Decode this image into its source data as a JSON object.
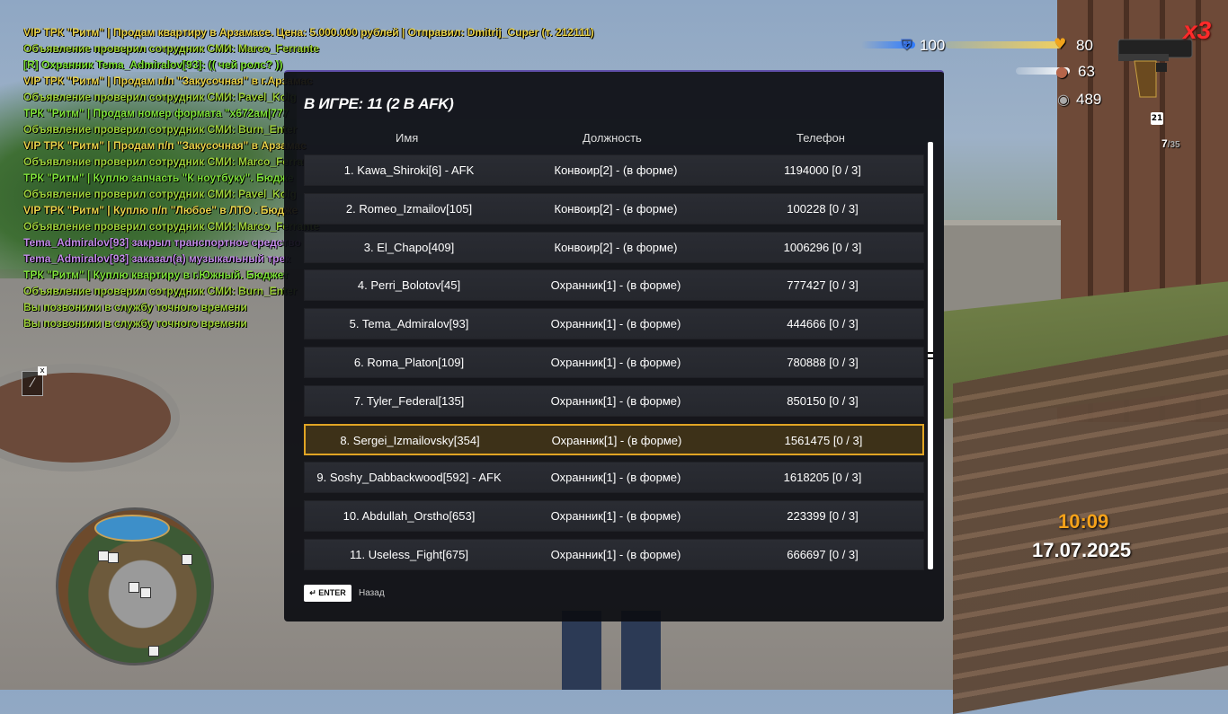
{
  "chat": [
    {
      "text": "VIP ТРК \"Ритм\" | Продам квартиру в Арзамасе. Цена: 5.000.000 рублей | Отправил: Dmitrij_Cuper (т. 212111)",
      "color": "yellow"
    },
    {
      "text": " Объявление проверил сотрудник СМИ: Marco_Ferrante",
      "color": "green"
    },
    {
      "text": "[R] Охранник Tema_Admiralov[93]: (( чей ролс? ))",
      "color": "lime"
    },
    {
      "text": "VIP ТРК \"Ритм\" | Продам п/п \"Закусочная\" в г.Арзамас",
      "color": "yellow"
    },
    {
      "text": " Объявление проверил сотрудник СМИ: Pavel_Kolg",
      "color": "green"
    },
    {
      "text": "ТРК \"Ритм\" | Продам номер формата \"х672ам|777",
      "color": "lime"
    },
    {
      "text": " Объявление проверил сотрудник СМИ: Burn_Enter",
      "color": "green"
    },
    {
      "text": "VIP ТРК \"Ритм\" | Продам п/п \"Закусочная\" в Арзамас",
      "color": "yellow"
    },
    {
      "text": " Объявление проверил сотрудник СМИ: Marco_Ferrante",
      "color": "green"
    },
    {
      "text": "ТРК \"Ритм\" | Куплю запчасть \"К ноутбуку\". Бюдже",
      "color": "lime"
    },
    {
      "text": " Объявление проверил сотрудник СМИ: Pavel_Kolg",
      "color": "green"
    },
    {
      "text": "VIP ТРК \"Ритм\" | Куплю п/п \"Любое\" в ЛТО . Бюдже",
      "color": "yellow"
    },
    {
      "text": " Объявление проверил сотрудник СМИ: Marco_Ferrante",
      "color": "green"
    },
    {
      "text": "Tema_Admiralov[93] закрыл транспортное средство",
      "color": "purple"
    },
    {
      "text": "Tema_Admiralov[93] заказал(а) музыкальный трек",
      "color": "purple"
    },
    {
      "text": "ТРК \"Ритм\" | Куплю квартиру в г.Южный. Бюджет",
      "color": "lime"
    },
    {
      "text": " Объявление проверил сотрудник СМИ: Burn_Enter",
      "color": "green"
    },
    {
      "text": "Вы позвонили в службу точного времени",
      "color": "green"
    },
    {
      "text": "Вы позвонили в службу точного времени",
      "color": "green"
    }
  ],
  "hud": {
    "armor": "100",
    "health": "80",
    "hunger": "63",
    "money": "489",
    "multiplier": "x3",
    "level": "21",
    "ammo": "7",
    "ammo_total": "35",
    "time": "10:09",
    "date": "17.07.2025",
    "armor_fraction": 1.0,
    "health_fraction": 0.8,
    "hunger_fraction": 0.63
  },
  "dialog": {
    "title": "В ИГРЕ: 11 (2 В AFK)",
    "columns": {
      "name": "Имя",
      "position": "Должность",
      "phone": "Телефон"
    },
    "rows": [
      {
        "name": "1. Kawa_Shiroki[6] - AFK",
        "position": "Конвоир[2] - (в форме)",
        "phone": "1194000 [0 / 3]"
      },
      {
        "name": "2. Romeo_Izmailov[105]",
        "position": "Конвоир[2] - (в форме)",
        "phone": "100228 [0 / 3]"
      },
      {
        "name": "3. El_Chapo[409]",
        "position": "Конвоир[2] - (в форме)",
        "phone": "1006296 [0 / 3]"
      },
      {
        "name": "4. Perri_Bolotov[45]",
        "position": "Охранник[1] - (в форме)",
        "phone": "777427 [0 / 3]"
      },
      {
        "name": "5. Tema_Admiralov[93]",
        "position": "Охранник[1] - (в форме)",
        "phone": "444666 [0 / 3]"
      },
      {
        "name": "6. Roma_Platon[109]",
        "position": "Охранник[1] - (в форме)",
        "phone": "780888 [0 / 3]"
      },
      {
        "name": "7. Tyler_Federal[135]",
        "position": "Охранник[1] - (в форме)",
        "phone": "850150 [0 / 3]"
      },
      {
        "name": "8. Sergei_Izmailovsky[354]",
        "position": "Охранник[1] - (в форме)",
        "phone": "1561475 [0 / 3]",
        "selected": true
      },
      {
        "name": "9. Soshy_Dabbackwood[592] - AFK",
        "position": "Охранник[1] - (в форме)",
        "phone": "1618205 [0 / 3]"
      },
      {
        "name": "10. Abdullah_Orstho[653]",
        "position": "Охранник[1] - (в форме)",
        "phone": "223399 [0 / 3]"
      },
      {
        "name": "11. Useless_Fight[675]",
        "position": "Охранник[1] - (в форме)",
        "phone": "666697 [0 / 3]"
      }
    ],
    "enter_label": "ENTER",
    "back_label": "Назад"
  },
  "icons": {
    "armor": "armor-icon",
    "health": "heart-icon",
    "hunger": "food-icon",
    "money": "coin-icon",
    "weapon": "pistol-icon"
  },
  "colors": {
    "accent": "#e0a424",
    "time": "#f5a21a",
    "multiplier": "#ff2a2a",
    "chat_yellow": "#e8d24a",
    "chat_green": "#9fd23b",
    "chat_lime": "#7fe23a",
    "chat_purple": "#c28be8"
  }
}
